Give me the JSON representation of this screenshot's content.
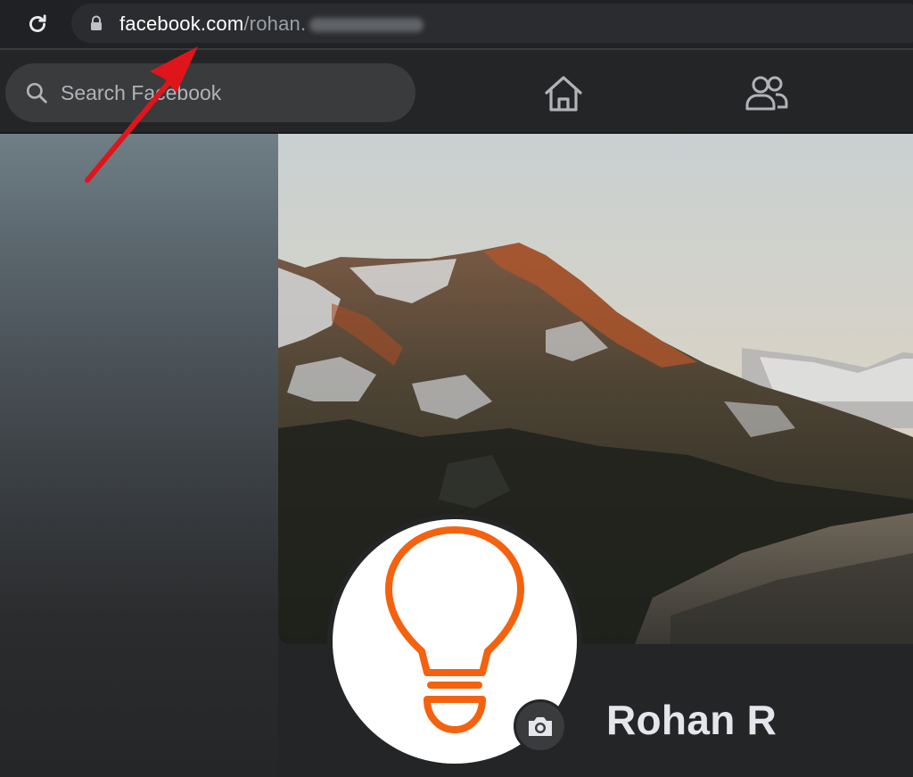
{
  "browser": {
    "url_domain": "facebook.com",
    "url_path": "/rohan.",
    "reload_icon": "reload-icon",
    "lock_icon": "lock-icon"
  },
  "header": {
    "search_placeholder": "Search Facebook",
    "search_icon": "search-icon",
    "nav": [
      {
        "name": "home",
        "icon": "home-icon"
      },
      {
        "name": "friends",
        "icon": "friends-icon"
      }
    ]
  },
  "profile": {
    "name": "Rohan R",
    "avatar_icon": "lightbulb-icon",
    "camera_icon": "camera-icon"
  },
  "annotation": {
    "icon": "red-arrow-icon",
    "color": "#e0151c"
  },
  "colors": {
    "bulb_orange": "#f4620f",
    "background": "#242526",
    "search_bg": "#3a3b3c"
  }
}
